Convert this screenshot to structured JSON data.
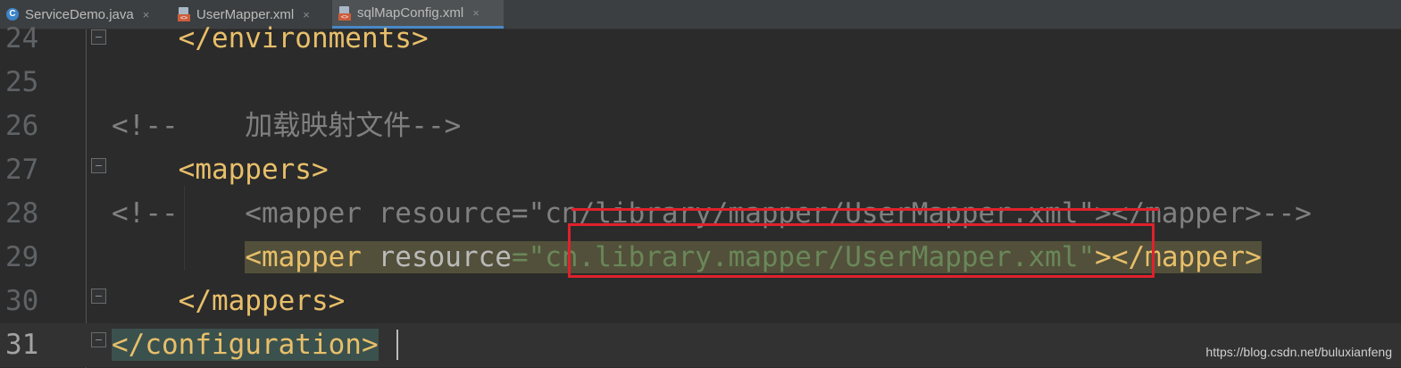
{
  "tabs": [
    {
      "label": "ServiceDemo.java",
      "icon": "java-class-icon",
      "active": false
    },
    {
      "label": "UserMapper.xml",
      "icon": "xml-file-icon",
      "active": false
    },
    {
      "label": "sqlMapConfig.xml",
      "icon": "xml-file-icon",
      "active": true
    }
  ],
  "close_glyph": "×",
  "lines": [
    {
      "number": "24",
      "parts": [
        {
          "text": "    </environments>",
          "style": "tag"
        }
      ]
    },
    {
      "number": "25",
      "parts": []
    },
    {
      "number": "26",
      "parts": [
        {
          "text": "<!--    加载映射文件-->",
          "style": "cmt"
        }
      ]
    },
    {
      "number": "27",
      "parts": [
        {
          "text": "    <mappers>",
          "style": "tag"
        }
      ]
    },
    {
      "number": "28",
      "parts": [
        {
          "text": "<!--    <mapper resource=\"cn/library/mapper/UserMapper.xml\"></mapper>-->",
          "style": "cmt"
        }
      ]
    },
    {
      "number": "29",
      "parts": [
        {
          "text": "        ",
          "style": "plain"
        },
        {
          "text": "<mapper ",
          "style": "tag"
        },
        {
          "text": "resource",
          "style": "attr"
        },
        {
          "text": "=\"",
          "style": "val"
        },
        {
          "text": "cn.library.mapper/UserMapper.xml",
          "style": "val"
        },
        {
          "text": "\"",
          "style": "val"
        },
        {
          "text": "></mapper>",
          "style": "tag"
        }
      ]
    },
    {
      "number": "30",
      "parts": [
        {
          "text": "    </mappers>",
          "style": "tag"
        }
      ]
    },
    {
      "number": "31",
      "parts": [
        {
          "text": "</configuration>",
          "style": "tag"
        }
      ]
    }
  ],
  "watermark": "https://blog.csdn.net/buluxianfeng",
  "colors": {
    "tag": "#e8bf6a",
    "attr": "#bababa",
    "value": "#6a8759",
    "comment": "#808080",
    "annotation_red": "#e0212b",
    "tab_active_underline": "#4a88c7"
  }
}
